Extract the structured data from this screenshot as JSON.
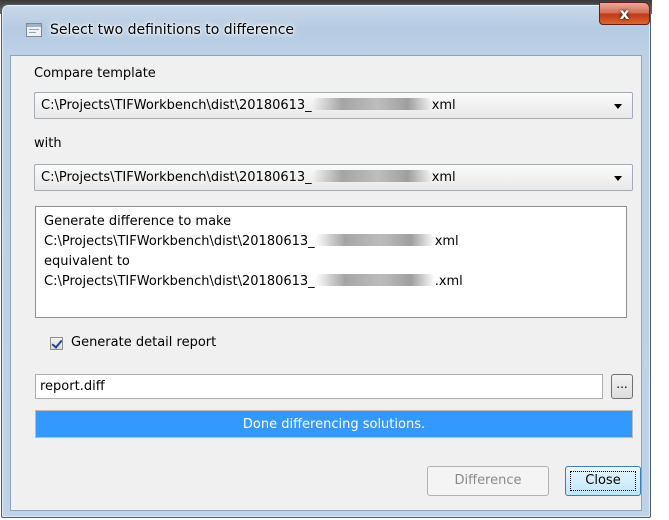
{
  "window": {
    "title": "Select two definitions to difference",
    "close_glyph": "x"
  },
  "form": {
    "compare_label": "Compare template",
    "compare_value": "C:\\Projects\\TIFWorkbench\\dist\\20180613_",
    "compare_suffix": "xml",
    "with_label": "with",
    "with_value": "C:\\Projects\\TIFWorkbench\\dist\\20180613_",
    "with_suffix": "xml"
  },
  "description": {
    "line1": "Generate difference to make",
    "line2_prefix": "C:\\Projects\\TIFWorkbench\\dist\\20180613_",
    "line2_suffix": "xml",
    "line3": "equivalent to",
    "line4_prefix": "C:\\Projects\\TIFWorkbench\\dist\\20180613_",
    "line4_suffix": ".xml"
  },
  "report": {
    "checkbox_label": "Generate detail report",
    "checked": true,
    "filename": "report.diff",
    "browse_label": "..."
  },
  "progress": {
    "text": "Done differencing solutions.",
    "value": 1.0,
    "color": "#3399ff"
  },
  "buttons": {
    "difference": "Difference",
    "close": "Close"
  }
}
